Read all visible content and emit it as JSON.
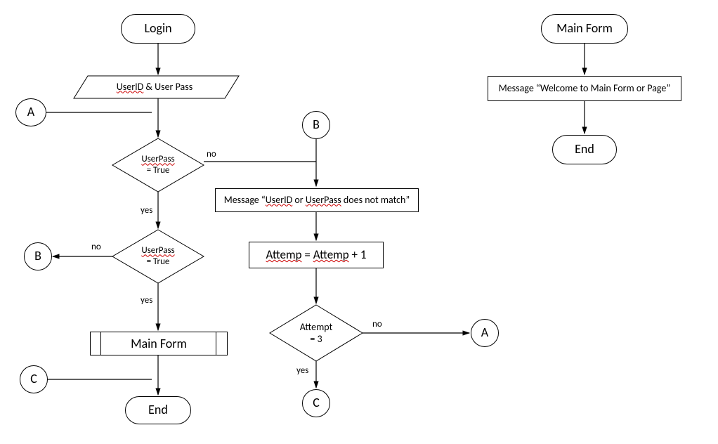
{
  "nodes": {
    "login": "Login",
    "input": "UserID & User Pass",
    "connA": "A",
    "dec1a": "UserPass",
    "dec1b": "= True",
    "dec2a": "UserPass",
    "dec2b": "= True",
    "connB_left": "B",
    "mainform": "Main Form",
    "connC_left": "C",
    "end_left": "End",
    "connB_top": "B",
    "msg_nomatch": "Message “UserID or UserPass does not match”",
    "attemp_inc": "Attemp = Attemp + 1",
    "dec3a": "Attempt",
    "dec3b": "= 3",
    "connA_right": "A",
    "connC_bottom": "C",
    "mainform_top": "Main Form",
    "msg_welcome": "Message “Welcome to Main Form or Page”",
    "end_right": "End"
  },
  "labels": {
    "yes": "yes",
    "no": "no"
  }
}
